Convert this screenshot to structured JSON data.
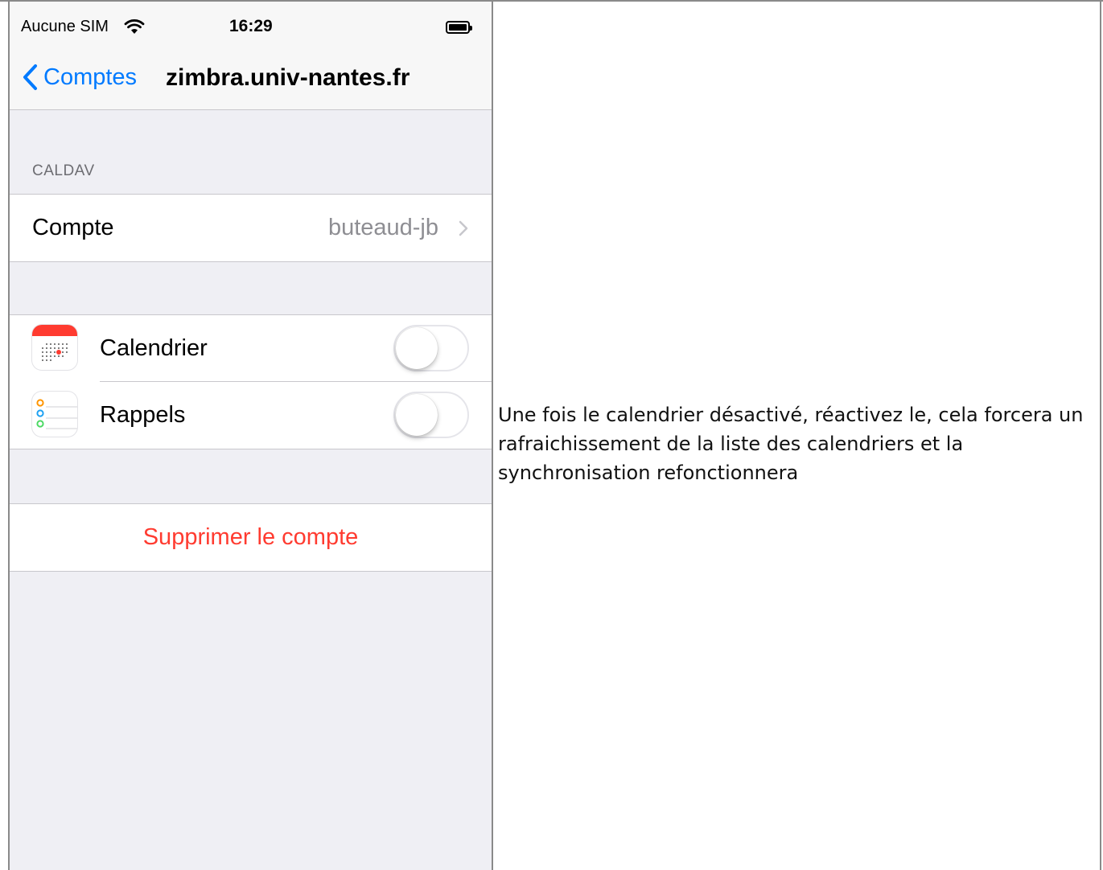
{
  "status_bar": {
    "carrier": "Aucune SIM",
    "time": "16:29",
    "wifi_icon": "wifi-icon",
    "battery_icon": "battery-icon"
  },
  "nav": {
    "back_label": "Comptes",
    "title": "zimbra.univ-nantes.fr",
    "accent": "#007aff"
  },
  "section": {
    "header": "CALDAV"
  },
  "account_row": {
    "label": "Compte",
    "value": "buteaud-jb"
  },
  "services": [
    {
      "label": "Calendrier",
      "icon": "calendar-app-icon",
      "enabled": false
    },
    {
      "label": "Rappels",
      "icon": "reminders-app-icon",
      "enabled": false
    }
  ],
  "delete": {
    "label": "Supprimer le compte",
    "color": "#ff3b30"
  },
  "note": {
    "text": "Une fois le calendrier désactivé, réactivez le, cela forcera un rafraichissement de la liste des calendriers et la synchronisation refonctionnera"
  }
}
